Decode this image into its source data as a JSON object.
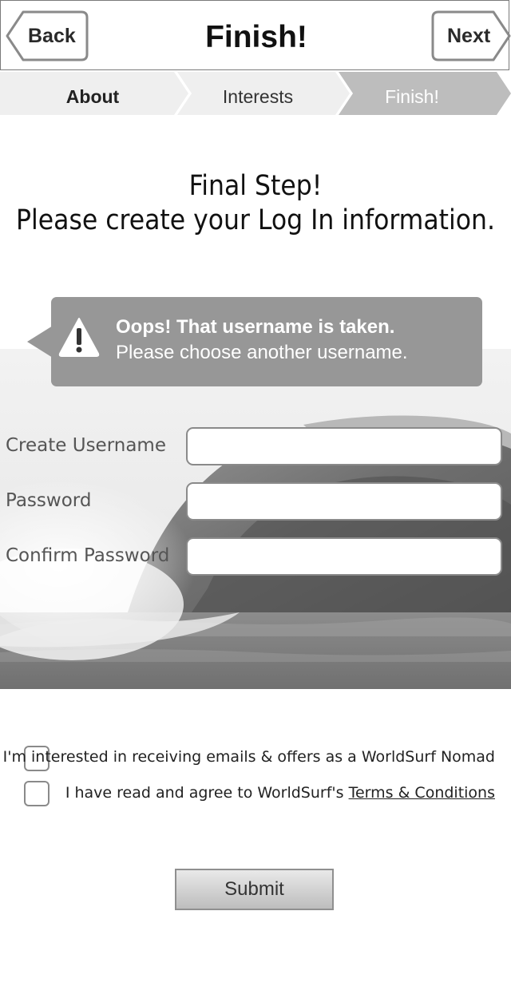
{
  "header": {
    "title": "Finish!",
    "back_label": "Back",
    "next_label": "Next"
  },
  "steps": {
    "items": [
      "About",
      "Interests",
      "Finish!"
    ],
    "active_index": 2
  },
  "heading": {
    "line1": "Final Step!",
    "line2": "Please create your Log In information."
  },
  "alert": {
    "icon": "warning-icon",
    "title": "Oops! That username is taken.",
    "body": "Please choose another username."
  },
  "form": {
    "username_label": "Create Username",
    "username_value": "",
    "password_label": "Password",
    "password_value": "",
    "confirm_label": "Confirm Password",
    "confirm_value": ""
  },
  "options": {
    "emails_label": "I'm interested in receiving emails & offers as a WorldSurf Nomad",
    "emails_checked": false,
    "terms_prefix": "I have read and agree to WorldSurf's ",
    "terms_link": "Terms & Conditions",
    "terms_checked": false
  },
  "submit_label": "Submit",
  "colors": {
    "alert_bg": "#979797",
    "step_active_bg": "#bdbdbd",
    "step_inactive_bg": "#efefef",
    "border": "#8a8a8a"
  }
}
